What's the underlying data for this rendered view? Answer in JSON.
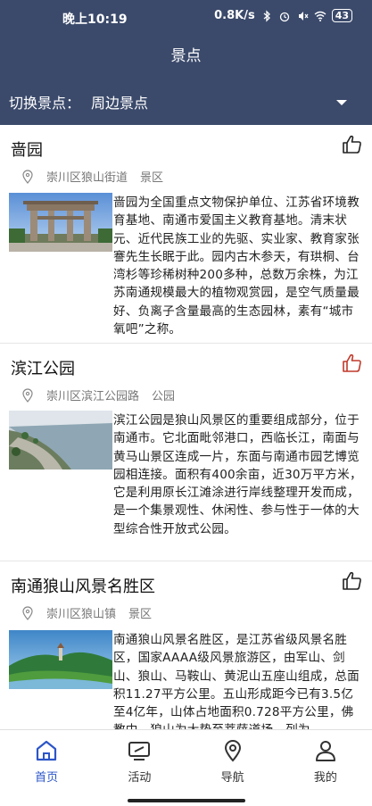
{
  "status": {
    "time": "晚上10:19",
    "speed": "0.8K/s",
    "battery": "43"
  },
  "header": {
    "title": "景点"
  },
  "switcher": {
    "label": "切换景点：",
    "value": "周边景点"
  },
  "spots": [
    {
      "name": "啬园",
      "district": "崇川区狼山街道",
      "category": "景区",
      "liked": false,
      "description": "啬园为全国重点文物保护单位、江苏省环境教育基地、南通市爱国主义教育基地。清末状元、近代民族工业的先驱、实业家、教育家张謇先生长眠于此。园内古木参天，有珙桐、台湾杉等珍稀树种200多种，总数万余株，为江苏南通规模最大的植物观赏园，是空气质量最好、负离子含量最高的生态园林，素有“城市氧吧”之称。"
    },
    {
      "name": "滨江公园",
      "district": "崇川区滨江公园路",
      "category": "公园",
      "liked": true,
      "description": "滨江公园是狼山风景区的重要组成部分，位于南通市。它北面毗邻港口，西临长江，南面与黄马山景区连成一片，东面与南通市园艺博览园相连接。面积有400余亩，近30万平方米，它是利用原长江滩涂进行岸线整理开发而成，是一个集景观性、休闲性、参与性于一体的大型综合性开放式公园。"
    },
    {
      "name": "南通狼山风景名胜区",
      "district": "崇川区狼山镇",
      "category": "景区",
      "liked": false,
      "description": "南通狼山风景名胜区，是江苏省级风景名胜区，国家AAAA级风景旅游区，由军山、剑山、狼山、马鞍山、黄泥山五座山组成，总面积11.27平方公里。五山形成距今已有3.5亿至4亿年，山体占地面积0.728平方公里，佛教中，狼山为大势至菩萨道场，列为"
    }
  ],
  "tabs": [
    {
      "label": "首页",
      "icon": "home-icon",
      "active": true
    },
    {
      "label": "活动",
      "icon": "activity-icon",
      "active": false
    },
    {
      "label": "导航",
      "icon": "navigation-icon",
      "active": false
    },
    {
      "label": "我的",
      "icon": "profile-icon",
      "active": false
    }
  ],
  "colors": {
    "header_bg": "#3b4a6b",
    "tab_active": "#2c55c8",
    "liked": "#c0392b"
  }
}
